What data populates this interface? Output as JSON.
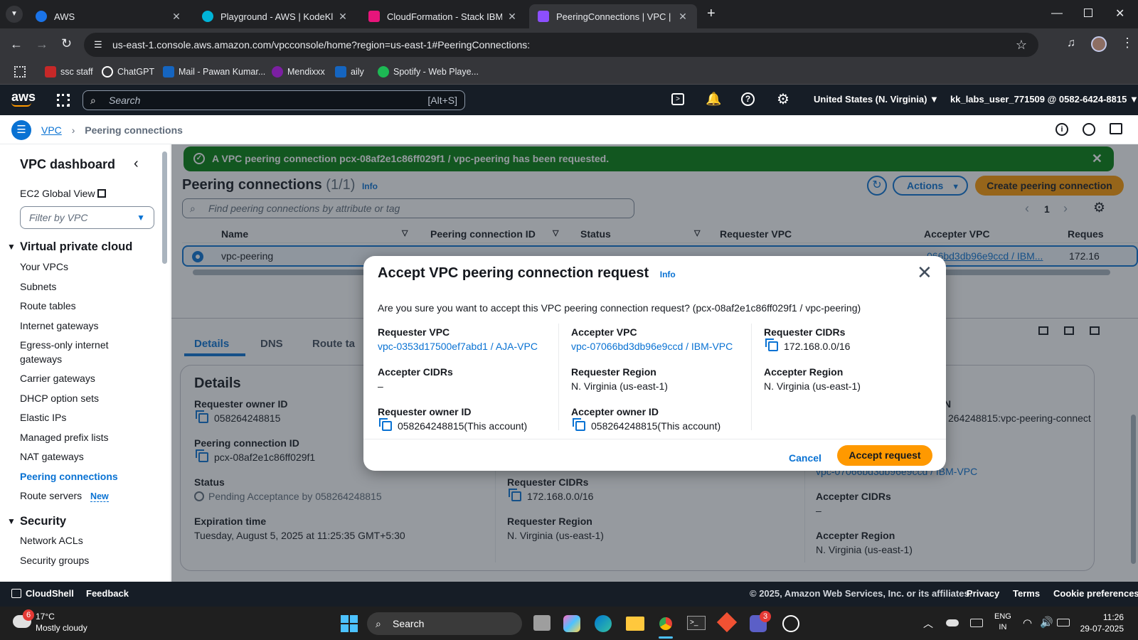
{
  "browser": {
    "tabs": [
      {
        "title": "AWS",
        "color": "#1a73e8"
      },
      {
        "title": "Playground - AWS | KodeKloud",
        "color": "#00b4d8"
      },
      {
        "title": "CloudFormation - Stack IBM-VP",
        "color": "#e7157b"
      },
      {
        "title": "PeeringConnections | VPC | us-e",
        "color": "#8c4fff"
      }
    ],
    "url": "us-east-1.console.aws.amazon.com/vpcconsole/home?region=us-east-1#PeeringConnections:",
    "bookmarks": [
      {
        "label": "ssc staff",
        "color": "#c62828"
      },
      {
        "label": "ChatGPT",
        "color": "#ffffff"
      },
      {
        "label": "Mail - Pawan Kumar...",
        "color": "#1565c0"
      },
      {
        "label": "Mendixxx",
        "color": "#7b1fa2"
      },
      {
        "label": "aily",
        "color": "#1565c0"
      },
      {
        "label": "Spotify - Web Playe...",
        "color": "#1db954"
      }
    ]
  },
  "aws": {
    "logo": "aws",
    "search_placeholder": "Search",
    "search_shortcut": "[Alt+S]",
    "region": "United States (N. Virginia)",
    "account": "kk_labs_user_771509 @ 0582-6424-8815"
  },
  "breadcrumb": {
    "root": "VPC",
    "current": "Peering connections"
  },
  "sidebar": {
    "title": "VPC dashboard",
    "global_view": "EC2 Global View",
    "filter_placeholder": "Filter by VPC",
    "section1": "Virtual private cloud",
    "items": [
      "Your VPCs",
      "Subnets",
      "Route tables",
      "Internet gateways",
      "Egress-only internet",
      "gateways",
      "Carrier gateways",
      "DHCP option sets",
      "Elastic IPs",
      "Managed prefix lists",
      "NAT gateways",
      "Peering connections",
      "Route servers"
    ],
    "new_badge": "New",
    "section2": "Security",
    "items2": [
      "Network ACLs",
      "Security groups"
    ]
  },
  "main": {
    "flash": "A VPC peering connection pcx-08af2e1c86ff029f1 / vpc-peering has been requested.",
    "title": "Peering connections",
    "count": "(1/1)",
    "info": "Info",
    "actions": "Actions",
    "create": "Create peering connection",
    "search_placeholder": "Find peering connections by attribute or tag",
    "page": "1",
    "columns": [
      "Name",
      "Peering connection ID",
      "Status",
      "Requester VPC",
      "Accepter VPC",
      "Reques"
    ],
    "row": {
      "name": "vpc-peering",
      "accepter": "066bd3db96e9ccd / IBM...",
      "requester_cidr": "172.16"
    },
    "tabs": [
      "Details",
      "DNS",
      "Route ta"
    ],
    "details_title": "Details",
    "details": {
      "requester_owner_label": "Requester owner ID",
      "requester_owner": "058264248815",
      "peering_id_label": "Peering connection ID",
      "peering_id": "pcx-08af2e1c86ff029f1",
      "status_label": "Status",
      "status": "Pending Acceptance by 058264248815",
      "expiration_label": "Expiration time",
      "expiration": "Tuesday, August 5, 2025 at 11:25:35 GMT+5:30",
      "req_cidrs_label": "Requester CIDRs",
      "req_cidrs": "172.168.0.0/16",
      "req_region_label": "Requester Region",
      "req_region": "N. Virginia (us-east-1)",
      "arn_partial": "N",
      "arn": "264248815:vpc-peering-connect",
      "acc_vpc": "vpc-07066bd3db96e9ccd / IBM-VPC",
      "acc_cidrs_label": "Accepter CIDRs",
      "acc_cidrs": "–",
      "acc_region_label": "Accepter Region",
      "acc_region": "N. Virginia (us-east-1)"
    }
  },
  "modal": {
    "title": "Accept VPC peering connection request",
    "info": "Info",
    "question": "Are you sure you want to accept this VPC peering connection request? (pcx-08af2e1c86ff029f1 / vpc-peering)",
    "requester_vpc_label": "Requester VPC",
    "requester_vpc": "vpc-0353d17500ef7abd1 / AJA-VPC",
    "accepter_vpc_label": "Accepter VPC",
    "accepter_vpc": "vpc-07066bd3db96e9ccd / IBM-VPC",
    "requester_cidrs_label": "Requester CIDRs",
    "requester_cidrs": "172.168.0.0/16",
    "accepter_cidrs_label": "Accepter CIDRs",
    "accepter_cidrs": "–",
    "requester_region_label": "Requester Region",
    "requester_region": "N. Virginia (us-east-1)",
    "accepter_region_label": "Accepter Region",
    "accepter_region": "N. Virginia (us-east-1)",
    "requester_owner_label": "Requester owner ID",
    "requester_owner": "058264248815(This account)",
    "accepter_owner_label": "Accepter owner ID",
    "accepter_owner": "058264248815(This account)",
    "cancel": "Cancel",
    "accept": "Accept request"
  },
  "footer": {
    "cloudshell": "CloudShell",
    "feedback": "Feedback",
    "copyright": "© 2025, Amazon Web Services, Inc. or its affiliates.",
    "privacy": "Privacy",
    "terms": "Terms",
    "cookies": "Cookie preferences"
  },
  "taskbar": {
    "temp": "17°C",
    "weather": "Mostly cloudy",
    "weather_badge": "6",
    "search": "Search",
    "teams_badge": "3",
    "lang1": "ENG",
    "lang2": "IN",
    "time": "11:26",
    "date": "29-07-2025"
  }
}
